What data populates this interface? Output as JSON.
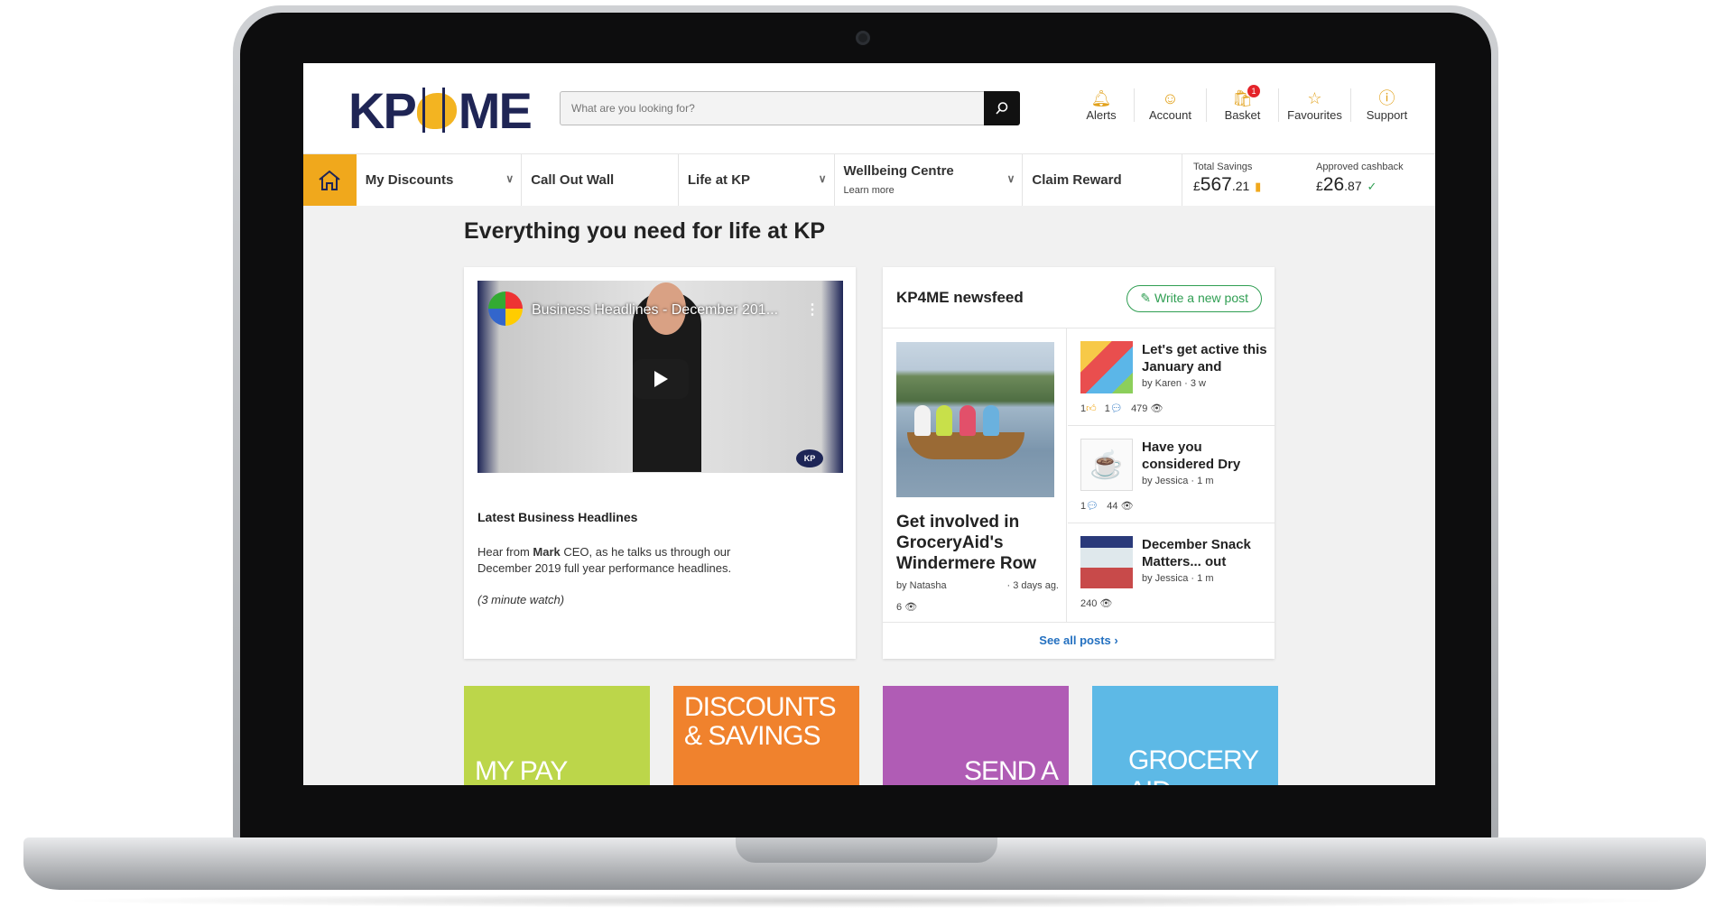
{
  "header": {
    "logo_left": "KP",
    "logo_right": "ME",
    "search_placeholder": "What are you looking for?",
    "icons": [
      {
        "label": "Alerts",
        "icon": "bell-icon"
      },
      {
        "label": "Account",
        "icon": "user-icon"
      },
      {
        "label": "Basket",
        "icon": "basket-icon",
        "badge": "1"
      },
      {
        "label": "Favourites",
        "icon": "star-icon"
      },
      {
        "label": "Support",
        "icon": "help-icon"
      }
    ]
  },
  "nav": {
    "items": [
      {
        "label": "My Discounts"
      },
      {
        "label": "Call Out Wall"
      },
      {
        "label": "Life at KP"
      },
      {
        "label": "Wellbeing Centre",
        "sub": "Learn more"
      },
      {
        "label": "Claim Reward"
      }
    ],
    "total_savings": {
      "label": "Total Savings",
      "currency": "£",
      "whole": "567",
      "decimal": ".21"
    },
    "cashback": {
      "label": "Approved cashback",
      "currency": "£",
      "whole": "26",
      "decimal": ".87"
    }
  },
  "main": {
    "title": "Everything you need for life at KP",
    "video": {
      "title": "Business Headlines - December 201...",
      "heading": "Latest Business Headlines",
      "desc_pre": "Hear from ",
      "desc_bold": "Mark",
      "desc_post": " CEO, as he talks us through our December 2019 full year performance headlines.",
      "note": "(3 minute watch)"
    },
    "newsfeed": {
      "title": "KP4ME newsfeed",
      "write_label": "Write a new post",
      "featured": {
        "title": "Get involved in GroceryAid's Windermere Row",
        "author": "by Natasha",
        "time": "· 3 days ag.",
        "views": "6"
      },
      "posts": [
        {
          "title": "Let's get active this January and",
          "by": "by Karen",
          "time": "· 3 w",
          "likes": "1",
          "comments": "1",
          "views": "479"
        },
        {
          "title": "Have you considered Dry",
          "by": "by Jessica",
          "time": "· 1 m",
          "comments": "1",
          "views": "44"
        },
        {
          "title": "December Snack Matters... out",
          "by": "by Jessica",
          "time": "· 1 m",
          "views": "240"
        }
      ],
      "see_all": "See all posts ›"
    },
    "tiles": [
      {
        "text": "MY PAY",
        "color": "#bcd64a"
      },
      {
        "text": "DISCOUNTS & SAVINGS",
        "color": "#f0822d"
      },
      {
        "text": "SEND A",
        "color": "#b05cb5"
      },
      {
        "text": "GROCERY AID",
        "color": "#5db9e6"
      }
    ]
  },
  "colors": {
    "accent": "#f0a81c",
    "navy": "#1f2555",
    "green": "#2f9e52",
    "link": "#2370c0"
  }
}
